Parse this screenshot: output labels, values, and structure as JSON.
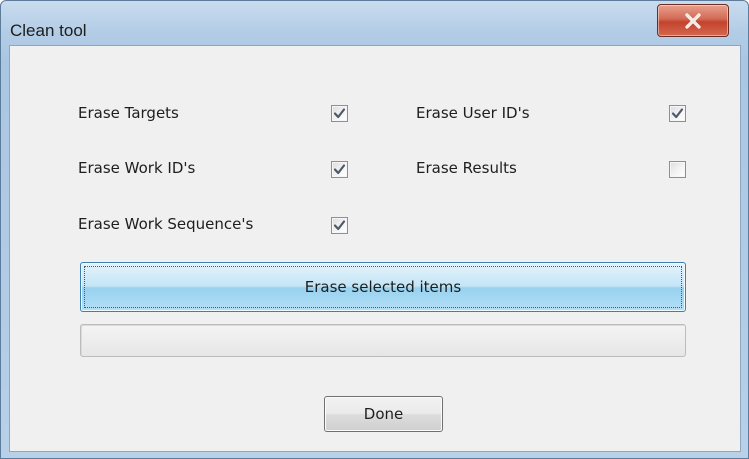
{
  "window": {
    "title": "Clean tool"
  },
  "options": [
    {
      "label": "Erase Targets",
      "checked": true
    },
    {
      "label": "Erase User ID's",
      "checked": true
    },
    {
      "label": "Erase Work ID's",
      "checked": true
    },
    {
      "label": "Erase Results",
      "checked": false
    },
    {
      "label": "Erase Work Sequence's",
      "checked": true
    }
  ],
  "actions": {
    "erase_label": "Erase selected items",
    "done_label": "Done"
  },
  "progress": {
    "fraction": 0
  },
  "icons": {
    "close": "close-icon",
    "check": "checkmark-icon"
  },
  "colors": {
    "close_button": "#c3432d",
    "erase_button": "#98d1ef",
    "checkmark": "#4d5a6b"
  }
}
